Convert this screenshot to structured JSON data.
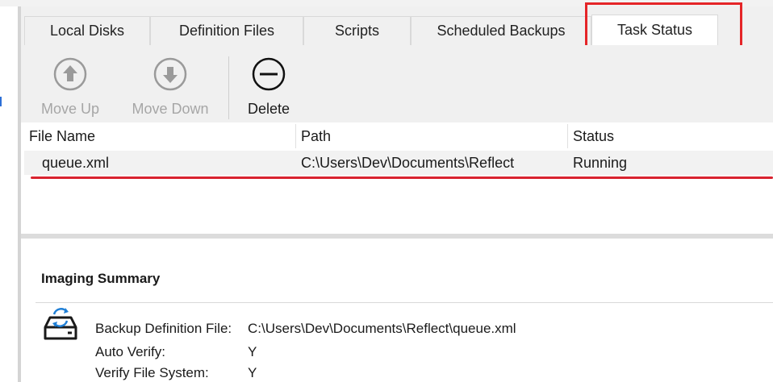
{
  "tabs": [
    {
      "label": "Local Disks",
      "active": false
    },
    {
      "label": "Definition Files",
      "active": false
    },
    {
      "label": "Scripts",
      "active": false
    },
    {
      "label": "Scheduled Backups",
      "active": false
    },
    {
      "label": "Task Status",
      "active": true
    }
  ],
  "toolbar": {
    "move_up": {
      "label": "Move Up",
      "icon": "arrow-up-circle-icon",
      "enabled": false
    },
    "move_down": {
      "label": "Move Down",
      "icon": "arrow-down-circle-icon",
      "enabled": false
    },
    "delete": {
      "label": "Delete",
      "icon": "minus-circle-icon",
      "enabled": true
    }
  },
  "table": {
    "columns": [
      "File Name",
      "Path",
      "Status"
    ],
    "rows": [
      {
        "file_name": "queue.xml",
        "path": "C:\\Users\\Dev\\Documents\\Reflect",
        "status": "Running"
      }
    ]
  },
  "summary": {
    "title": "Imaging Summary",
    "icon": "backup-drive-sync-icon",
    "fields": [
      {
        "label": "Backup Definition File:",
        "value": "C:\\Users\\Dev\\Documents\\Reflect\\queue.xml"
      },
      {
        "label": "Auto Verify:",
        "value": "Y"
      },
      {
        "label": "Verify File System:",
        "value": "Y"
      }
    ]
  },
  "colors": {
    "highlight": "#e52528",
    "underline": "#d9232f",
    "icon_blue": "#1f7fd6",
    "disabled_text": "#a6a6a6"
  }
}
